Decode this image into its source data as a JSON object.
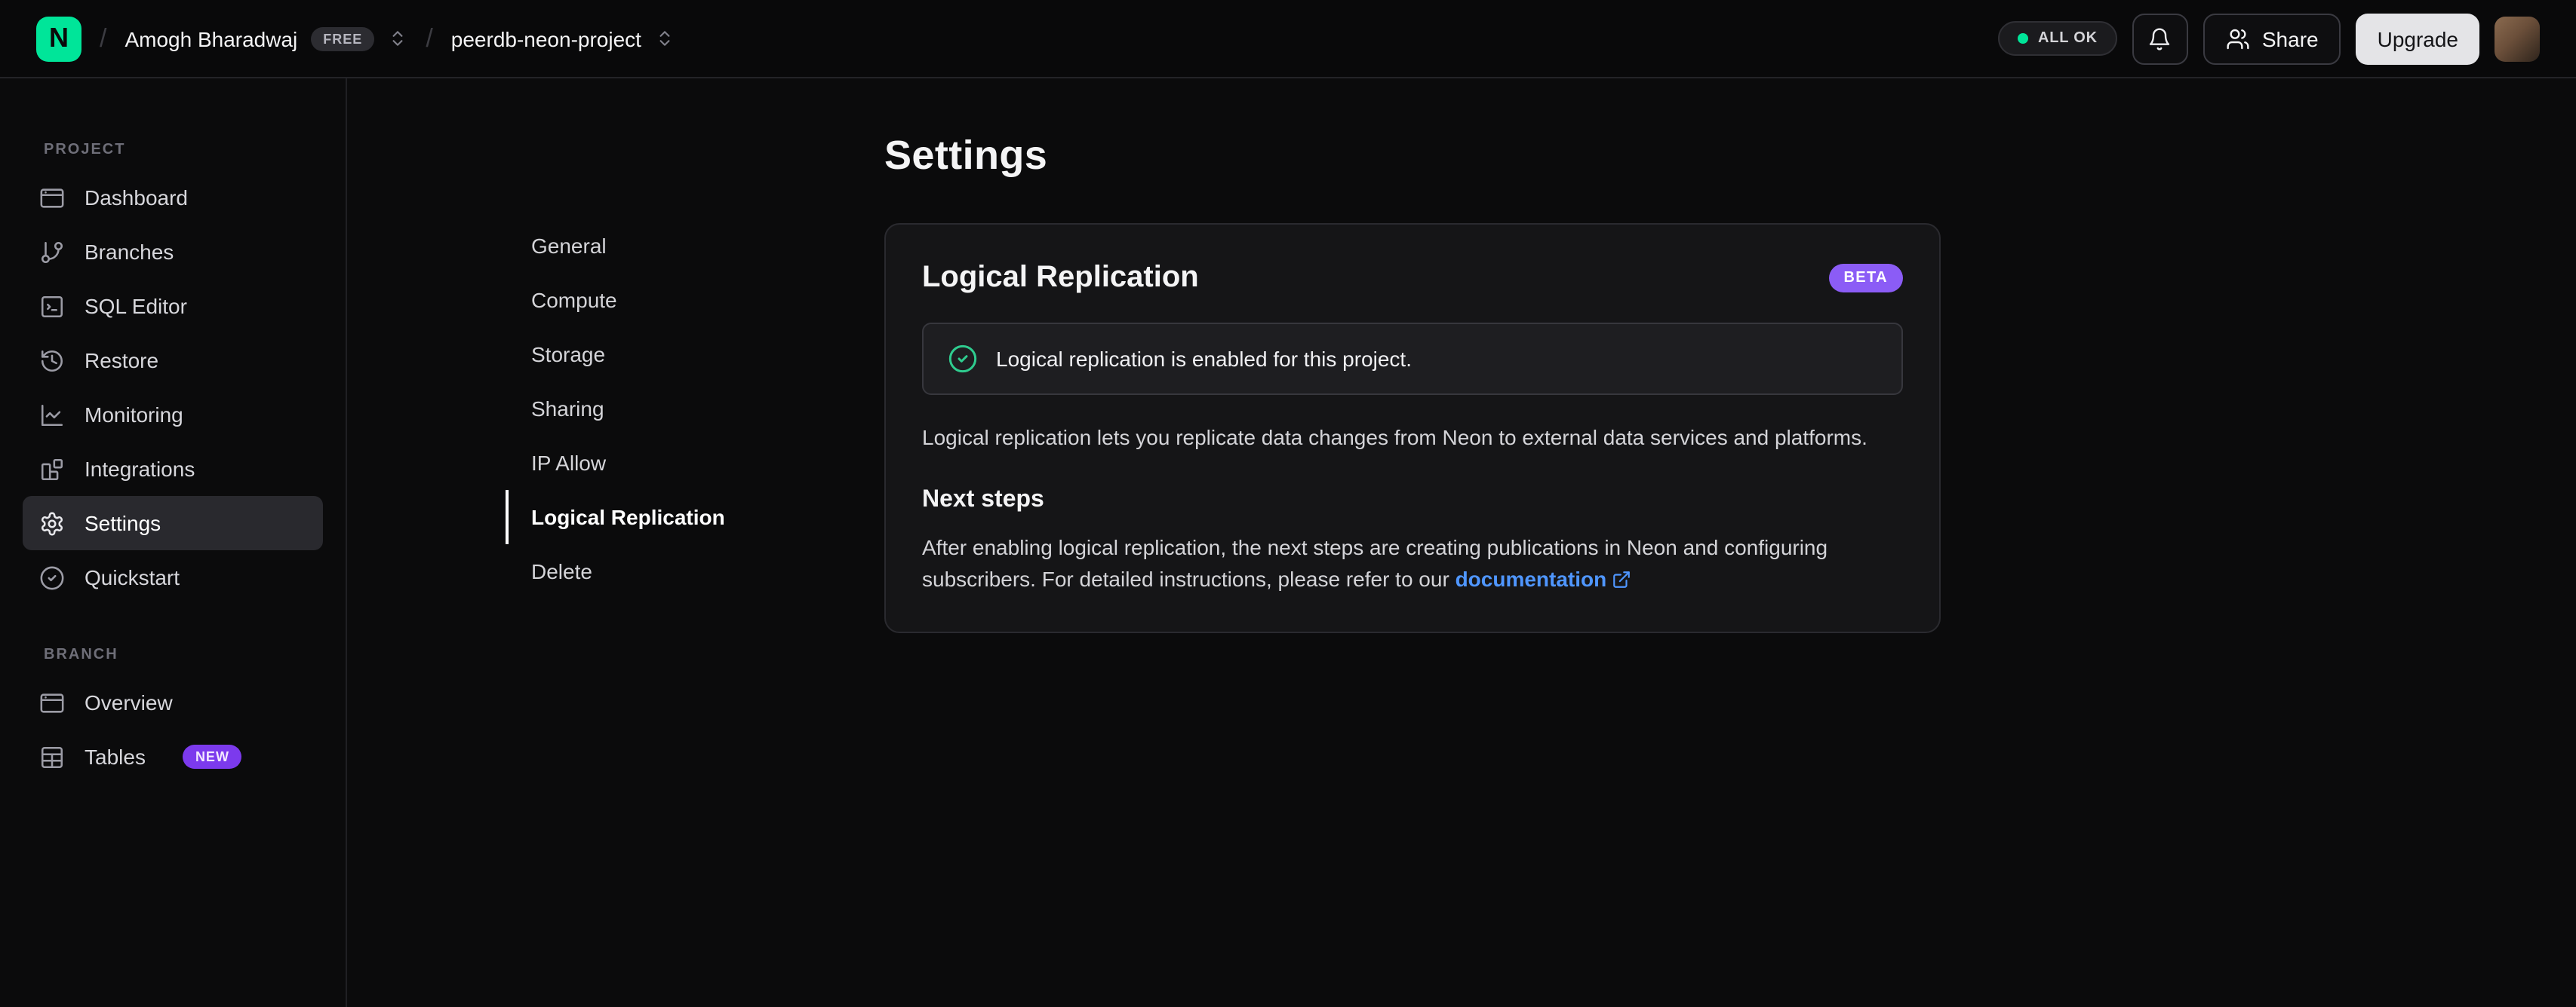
{
  "topbar": {
    "logo_letter": "N",
    "breadcrumb": {
      "org": "Amogh Bharadwaj",
      "org_badge": "FREE",
      "project": "peerdb-neon-project"
    },
    "status": "ALL OK",
    "share_label": "Share",
    "upgrade_label": "Upgrade"
  },
  "sidebar": {
    "sections": [
      {
        "label": "PROJECT",
        "items": [
          {
            "label": "Dashboard",
            "icon": "dashboard-icon"
          },
          {
            "label": "Branches",
            "icon": "git-branch-icon"
          },
          {
            "label": "SQL Editor",
            "icon": "sql-editor-icon"
          },
          {
            "label": "Restore",
            "icon": "restore-history-icon"
          },
          {
            "label": "Monitoring",
            "icon": "monitoring-chart-icon"
          },
          {
            "label": "Integrations",
            "icon": "integrations-icon"
          },
          {
            "label": "Settings",
            "icon": "gear-icon",
            "active": true
          },
          {
            "label": "Quickstart",
            "icon": "check-circle-icon"
          }
        ]
      },
      {
        "label": "BRANCH",
        "items": [
          {
            "label": "Overview",
            "icon": "overview-icon"
          },
          {
            "label": "Tables",
            "icon": "table-icon",
            "badge": "NEW"
          }
        ]
      }
    ]
  },
  "settings_nav": {
    "items": [
      "General",
      "Compute",
      "Storage",
      "Sharing",
      "IP Allow",
      "Logical Replication",
      "Delete"
    ],
    "active": "Logical Replication"
  },
  "main": {
    "title": "Settings",
    "card": {
      "title": "Logical Replication",
      "badge": "BETA",
      "alert": "Logical replication is enabled for this project.",
      "description": "Logical replication lets you replicate data changes from Neon to external data services and platforms.",
      "next_steps_title": "Next steps",
      "next_steps_text": "After enabling logical replication, the next steps are creating publications in Neon and configuring subscribers. For detailed instructions, please refer to our ",
      "link_label": "documentation"
    }
  },
  "colors": {
    "brand_green": "#00e599",
    "status_ok_green": "#00e599",
    "badge_purple": "#8b5cf6",
    "link_blue": "#4f96ff",
    "alert_check_green": "#2fcc8f",
    "background": "#0b0b0c",
    "card_background": "#151517"
  }
}
